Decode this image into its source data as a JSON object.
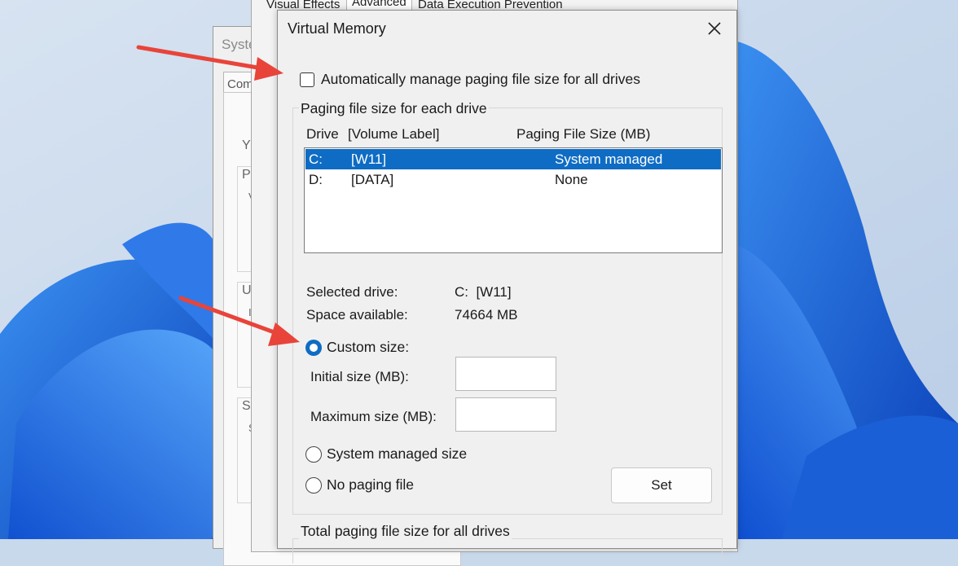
{
  "colors": {
    "accent": "#0e6cc4",
    "annotation_arrow": "#e8443a"
  },
  "background_window": {
    "title_fragment": "Syste",
    "tab_fragment": "Comp",
    "glyphs": [
      "Y",
      "P",
      "V",
      "U",
      "I",
      "S",
      "S"
    ]
  },
  "performance_window": {
    "tabs": [
      "Visual Effects",
      "Advanced",
      "Data Execution Prevention"
    ]
  },
  "dialog": {
    "title": "Virtual Memory",
    "close_icon": "close-icon",
    "auto_manage_label": "Automatically manage paging file size for all drives",
    "auto_manage_checked": false,
    "group_title": "Paging file size for each drive",
    "columns": {
      "drive": "Drive",
      "volume": "[Volume Label]",
      "size": "Paging File Size (MB)"
    },
    "drives": [
      {
        "letter": "C:",
        "label": "[W11]",
        "size": "System managed",
        "selected": true
      },
      {
        "letter": "D:",
        "label": "[DATA]",
        "size": "None",
        "selected": false
      }
    ],
    "selected_drive_label": "Selected drive:",
    "selected_drive_value": "C:  [W11]",
    "space_available_label": "Space available:",
    "space_available_value": "74664 MB",
    "custom_size_label": "Custom size:",
    "initial_size_label": "Initial size (MB):",
    "initial_size_value": "",
    "maximum_size_label": "Maximum size (MB):",
    "maximum_size_value": "",
    "system_managed_label": "System managed size",
    "no_paging_label": "No paging file",
    "selected_option": "custom",
    "set_label": "Set",
    "total_group_title": "Total paging file size for all drives"
  }
}
